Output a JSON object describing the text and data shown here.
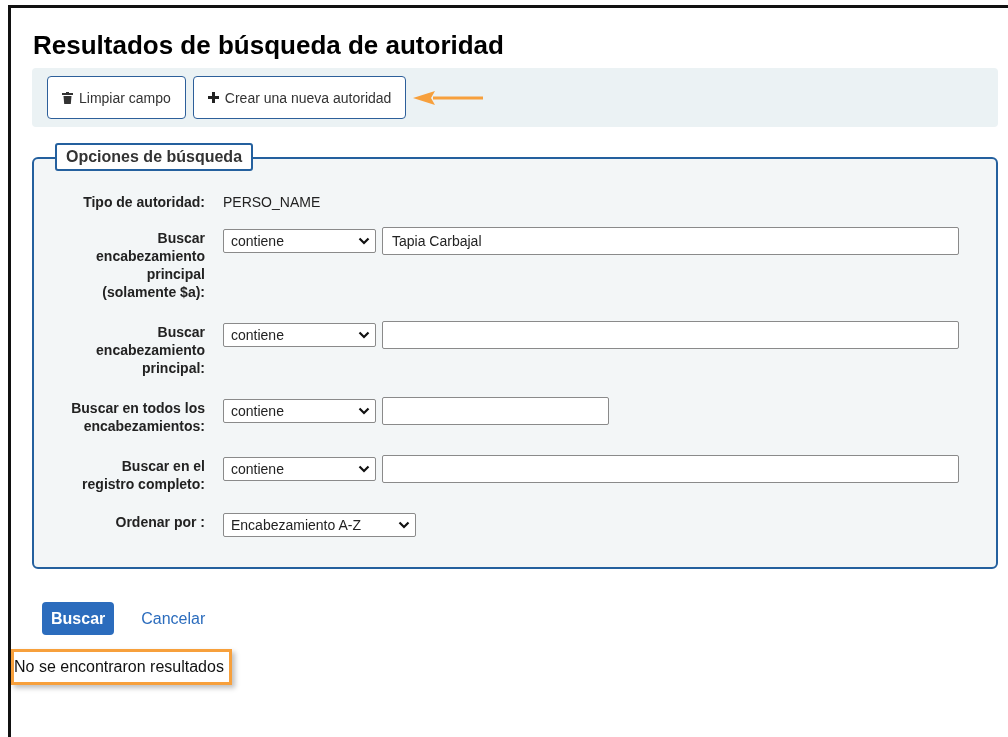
{
  "page": {
    "title": "Resultados de búsqueda de autoridad"
  },
  "toolbar": {
    "buttons": [
      {
        "kind": "clear",
        "label": "Limpiar campo",
        "highlighted": false
      },
      {
        "kind": "new",
        "label": "Crear una nueva autoridad",
        "highlighted": true
      }
    ]
  },
  "search_options": {
    "legend": "Opciones de búsqueda",
    "authority_type": {
      "label": "Tipo de autoridad:",
      "value": "PERSO_NAME"
    },
    "rows": [
      {
        "label": "Buscar encabezamiento principal (solamente $a):",
        "operator": "contiene",
        "value": "Tapia Carbajal"
      },
      {
        "label": "Buscar encabezamiento principal:",
        "operator": "contiene"
      },
      {
        "label": "Buscar en todos los encabezamientos:",
        "operator": "contiene"
      },
      {
        "label": "Buscar en el registro completo:",
        "operator": "contiene"
      }
    ],
    "sort": {
      "label": "Ordenar por :",
      "value": "Encabezamiento A-Z"
    }
  },
  "actions": {
    "submit": "Buscar",
    "cancel": "Cancelar"
  },
  "result": {
    "message": "No se encontraron resultados",
    "highlighted": true
  }
}
